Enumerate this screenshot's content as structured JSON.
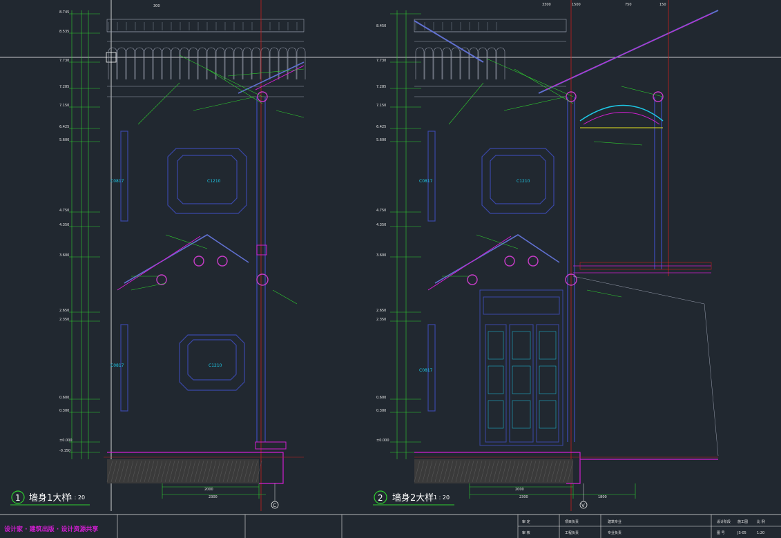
{
  "colors": {
    "background": "#212830",
    "wall": "#3a48a8",
    "dim": "#2fd12f",
    "text": "#e6e6e6",
    "magenta": "#d11ed1",
    "red": "#c81e1e",
    "cyan": "#1ec8e6",
    "yellow": "#e6e61e"
  },
  "detail1": {
    "number": "1",
    "title": "墙身1大样",
    "scale": "1 : 20",
    "axis": "C",
    "bottom_dims": [
      "2000",
      "2300"
    ],
    "level_labels": [
      "8.745",
      "8.535",
      "7.730",
      "7.285",
      "7.150",
      "6.425",
      "5.600",
      "4.750",
      "4.350",
      "3.600",
      "2.650",
      "2.350",
      "0.600",
      "0.300",
      "±0.000",
      "-0.150"
    ],
    "room_labels": [
      "C0817",
      "C1210",
      "C0817",
      "C1210"
    ]
  },
  "detail2": {
    "number": "2",
    "title": "墙身2大样",
    "scale": "1 : 20",
    "axis": "V",
    "bottom_dims": [
      "2000",
      "2300",
      "1800"
    ],
    "level_labels": [
      "8.450",
      "7.730",
      "7.285",
      "7.150",
      "6.425",
      "5.600",
      "4.750",
      "4.350",
      "3.600",
      "2.650",
      "2.350",
      "0.600",
      "0.300",
      "±0.000"
    ],
    "room_labels": [
      "C0817",
      "C1210",
      "C0817"
    ]
  },
  "top_dims": [
    "300",
    "3300",
    "1500",
    "750",
    "150"
  ],
  "watermark": "设计家 · 建筑出版 · 设计资源共享",
  "title_block": {
    "cells": [
      "审 定",
      "审 核",
      "项目负责",
      "工程负责",
      "建筑专业",
      "专业负责",
      "设计阶段",
      "施工图",
      "图 号",
      "JS-05",
      "比 例",
      "1:20"
    ]
  }
}
